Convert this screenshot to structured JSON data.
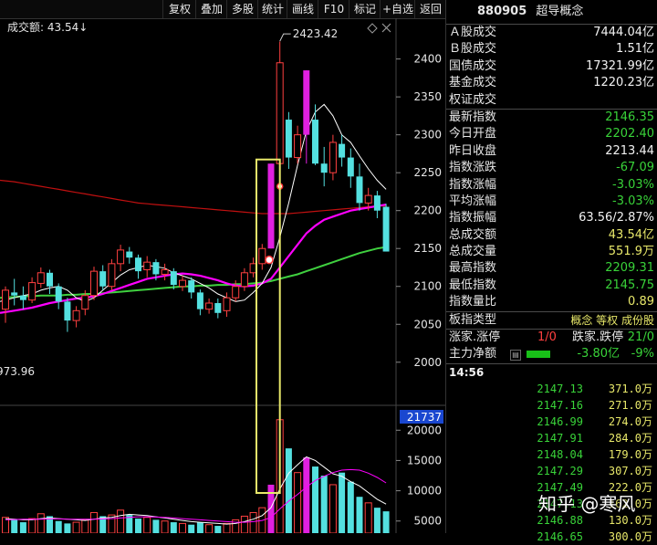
{
  "toolbar": {
    "tabs": [
      "复权",
      "叠加",
      "多股",
      "统计",
      "画线",
      "F10",
      "标记",
      "+自选",
      "返回"
    ]
  },
  "indicator_label": "成交额: 43.54↓",
  "chart_data": {
    "type": "candlestick",
    "ylim": [
      1960,
      2420
    ],
    "y_ticks": [
      2000,
      2050,
      2100,
      2150,
      2200,
      2250,
      2300,
      2350,
      2400
    ],
    "high_annotation": "2423.42",
    "low_annotation": "973.96",
    "colors": {
      "up": "#ff4040",
      "down": "#54e0e0",
      "limit_up": "#e020e0",
      "ma5": "#ffffff",
      "ma10": "#ff00ff",
      "ma20": "#3fd03f",
      "ma60": "#c01010",
      "highlight": "#e8e86a"
    },
    "candles": [
      [
        2070,
        2095,
        2052,
        2100
      ],
      [
        2092,
        2088,
        2075,
        2110
      ],
      [
        2088,
        2082,
        2070,
        2100
      ],
      [
        2082,
        2105,
        2078,
        2112
      ],
      [
        2104,
        2118,
        2098,
        2125
      ],
      [
        2118,
        2100,
        2090,
        2122
      ],
      [
        2100,
        2080,
        2070,
        2104
      ],
      [
        2080,
        2055,
        2040,
        2085
      ],
      [
        2055,
        2068,
        2046,
        2074
      ],
      [
        2070,
        2088,
        2062,
        2095
      ],
      [
        2088,
        2120,
        2082,
        2126
      ],
      [
        2120,
        2100,
        2095,
        2128
      ],
      [
        2100,
        2130,
        2095,
        2136
      ],
      [
        2130,
        2148,
        2120,
        2155
      ],
      [
        2146,
        2138,
        2130,
        2152
      ],
      [
        2138,
        2120,
        2110,
        2142
      ],
      [
        2122,
        2132,
        2112,
        2140
      ],
      [
        2132,
        2116,
        2108,
        2136
      ],
      [
        2116,
        2122,
        2108,
        2130
      ],
      [
        2120,
        2102,
        2096,
        2124
      ],
      [
        2100,
        2108,
        2094,
        2114
      ],
      [
        2108,
        2092,
        2084,
        2112
      ],
      [
        2092,
        2070,
        2062,
        2096
      ],
      [
        2070,
        2078,
        2064,
        2084
      ],
      [
        2078,
        2065,
        2058,
        2084
      ],
      [
        2068,
        2085,
        2060,
        2092
      ],
      [
        2085,
        2100,
        2080,
        2108
      ],
      [
        2100,
        2118,
        2094,
        2124
      ],
      [
        2118,
        2130,
        2112,
        2138
      ],
      [
        2130,
        2150,
        2122,
        2156
      ],
      [
        2150,
        2262,
        2150,
        2262
      ],
      [
        2262,
        2395,
        2262,
        2423
      ],
      [
        2320,
        2270,
        2255,
        2330
      ],
      [
        2270,
        2300,
        2262,
        2312
      ],
      [
        2300,
        2385,
        2262,
        2385
      ],
      [
        2320,
        2262,
        2260,
        2340
      ],
      [
        2262,
        2250,
        2232,
        2284
      ],
      [
        2250,
        2290,
        2240,
        2300
      ],
      [
        2288,
        2270,
        2258,
        2300
      ],
      [
        2270,
        2245,
        2230,
        2282
      ],
      [
        2245,
        2210,
        2200,
        2262
      ],
      [
        2210,
        2220,
        2200,
        2230
      ],
      [
        2220,
        2200,
        2190,
        2226
      ],
      [
        2205,
        2146,
        2146,
        2209
      ]
    ],
    "ma_lines": {
      "ma5": [
        2080,
        2085,
        2088,
        2090,
        2095,
        2098,
        2100,
        2095,
        2085,
        2080,
        2085,
        2095,
        2105,
        2115,
        2122,
        2125,
        2128,
        2126,
        2124,
        2118,
        2114,
        2110,
        2104,
        2098,
        2090,
        2085,
        2080,
        2082,
        2092,
        2104,
        2125,
        2165,
        2210,
        2260,
        2305,
        2330,
        2340,
        2325,
        2300,
        2290,
        2272,
        2255,
        2240,
        2228
      ],
      "ma10": [
        2065,
        2068,
        2070,
        2072,
        2075,
        2078,
        2080,
        2082,
        2084,
        2085,
        2087,
        2090,
        2094,
        2098,
        2102,
        2106,
        2110,
        2112,
        2114,
        2116,
        2117,
        2116,
        2114,
        2111,
        2108,
        2104,
        2101,
        2100,
        2101,
        2104,
        2110,
        2125,
        2140,
        2155,
        2170,
        2180,
        2188,
        2192,
        2196,
        2200,
        2202,
        2204,
        2206,
        2208
      ],
      "ma20": [
        2085,
        2086,
        2087,
        2087,
        2088,
        2088,
        2088,
        2089,
        2089,
        2090,
        2090,
        2091,
        2092,
        2093,
        2094,
        2095,
        2096,
        2097,
        2098,
        2099,
        2100,
        2100,
        2101,
        2101,
        2102,
        2102,
        2103,
        2103,
        2104,
        2105,
        2107,
        2110,
        2113,
        2116,
        2120,
        2124,
        2128,
        2132,
        2136,
        2140,
        2144,
        2147,
        2150,
        2152
      ],
      "ma60": [
        2240,
        2238,
        2236,
        2234,
        2232,
        2230,
        2228,
        2226,
        2224,
        2222,
        2220,
        2218,
        2216,
        2214,
        2212,
        2210,
        2209,
        2208,
        2207,
        2206,
        2205,
        2204,
        2203,
        2202,
        2201,
        2200,
        2199,
        2198,
        2197,
        2196,
        2196,
        2196,
        2196,
        2197,
        2198,
        2199,
        2200,
        2201,
        2202,
        2203,
        2204,
        2205,
        2206,
        2206
      ]
    },
    "highlight_range": [
      30,
      31
    ],
    "volume": {
      "ylim": [
        3000,
        22000
      ],
      "y_ticks": [
        5000,
        10000,
        15000,
        20000
      ],
      "current_label": "21737",
      "values": [
        5600,
        5200,
        4800,
        5400,
        6200,
        5800,
        5000,
        4600,
        4800,
        5200,
        6400,
        5800,
        6000,
        6800,
        6000,
        5400,
        5600,
        5200,
        5000,
        4800,
        4600,
        4400,
        4800,
        4400,
        4200,
        4600,
        5200,
        5800,
        6400,
        7200,
        11000,
        21737,
        17000,
        13000,
        15500,
        14000,
        12500,
        11000,
        13000,
        11500,
        9000,
        8000,
        7200,
        6600
      ],
      "ma5": [
        5400,
        5300,
        5200,
        5200,
        5400,
        5500,
        5400,
        5300,
        5200,
        5100,
        5300,
        5500,
        5600,
        5900,
        6100,
        6000,
        5900,
        5700,
        5500,
        5300,
        5100,
        4900,
        4800,
        4700,
        4600,
        4500,
        4600,
        4900,
        5300,
        5900,
        7200,
        10300,
        12900,
        14300,
        15600,
        15000,
        13900,
        12800,
        12400,
        11500,
        10800,
        9700,
        8600,
        7800
      ],
      "ma10": [
        5200,
        5250,
        5300,
        5300,
        5300,
        5350,
        5350,
        5300,
        5300,
        5300,
        5300,
        5350,
        5400,
        5500,
        5600,
        5700,
        5700,
        5650,
        5600,
        5500,
        5400,
        5300,
        5200,
        5100,
        5000,
        4900,
        4800,
        4800,
        4900,
        5100,
        5600,
        7000,
        8300,
        9400,
        10600,
        11700,
        12400,
        13000,
        13400,
        13500,
        13400,
        12900,
        12200,
        11300
      ]
    }
  },
  "side": {
    "code": "880905",
    "name": "超导概念",
    "rows_a": [
      {
        "k": "Ａ股成交",
        "v": "7444.04亿",
        "c": "white"
      },
      {
        "k": "Ｂ股成交",
        "v": "1.51亿",
        "c": "white"
      },
      {
        "k": "国债成交",
        "v": "17321.99亿",
        "c": "white"
      },
      {
        "k": "基金成交",
        "v": "1220.23亿",
        "c": "white"
      },
      {
        "k": "权证成交",
        "v": "",
        "c": "white"
      }
    ],
    "rows_b": [
      {
        "k": "最新指数",
        "v": "2146.35",
        "c": "green"
      },
      {
        "k": "今日开盘",
        "v": "2202.40",
        "c": "green"
      },
      {
        "k": "昨日收盘",
        "v": "2213.44",
        "c": "white"
      },
      {
        "k": "指数涨跌",
        "v": "-67.09",
        "c": "green"
      },
      {
        "k": "指数涨幅",
        "v": "-3.03%",
        "c": "green"
      },
      {
        "k": "平均涨幅",
        "v": "-3.03%",
        "c": "green"
      },
      {
        "k": "指数振幅",
        "v": "63.56/2.87%",
        "c": "white"
      },
      {
        "k": "总成交额",
        "v": "43.54亿",
        "c": "yellow"
      },
      {
        "k": "总成交量",
        "v": "551.9万",
        "c": "yellow"
      },
      {
        "k": "最高指数",
        "v": "2209.31",
        "c": "green"
      },
      {
        "k": "最低指数",
        "v": "2145.75",
        "c": "green"
      },
      {
        "k": "指数量比",
        "v": "0.89",
        "c": "yellow"
      }
    ],
    "board_type_label": "板指类型",
    "board_type_value": "概念 等权 成份股",
    "limit_label": "涨家.涨停",
    "limit_value": "1/0",
    "fall_label": "跌家.跌停",
    "fall_value": "21/0",
    "flow_label": "主力净额",
    "flow_value": "-3.80亿",
    "flow_pct": "-9%",
    "tick_time": "14:56",
    "ticks": [
      {
        "p": "2147.13",
        "v": "371.0万"
      },
      {
        "p": "2147.16",
        "v": "271.0万"
      },
      {
        "p": "2146.99",
        "v": "274.0万"
      },
      {
        "p": "2147.91",
        "v": "284.0万"
      },
      {
        "p": "2148.04",
        "v": "179.0万"
      },
      {
        "p": "2147.29",
        "v": "307.0万"
      },
      {
        "p": "2147.49",
        "v": "222.0万"
      },
      {
        "p": "2147.13",
        "v": "162.0万"
      },
      {
        "p": "2146.88",
        "v": "130.0万"
      },
      {
        "p": "2146.65",
        "v": "300.0万"
      }
    ]
  },
  "watermark": "知乎 @寒风"
}
